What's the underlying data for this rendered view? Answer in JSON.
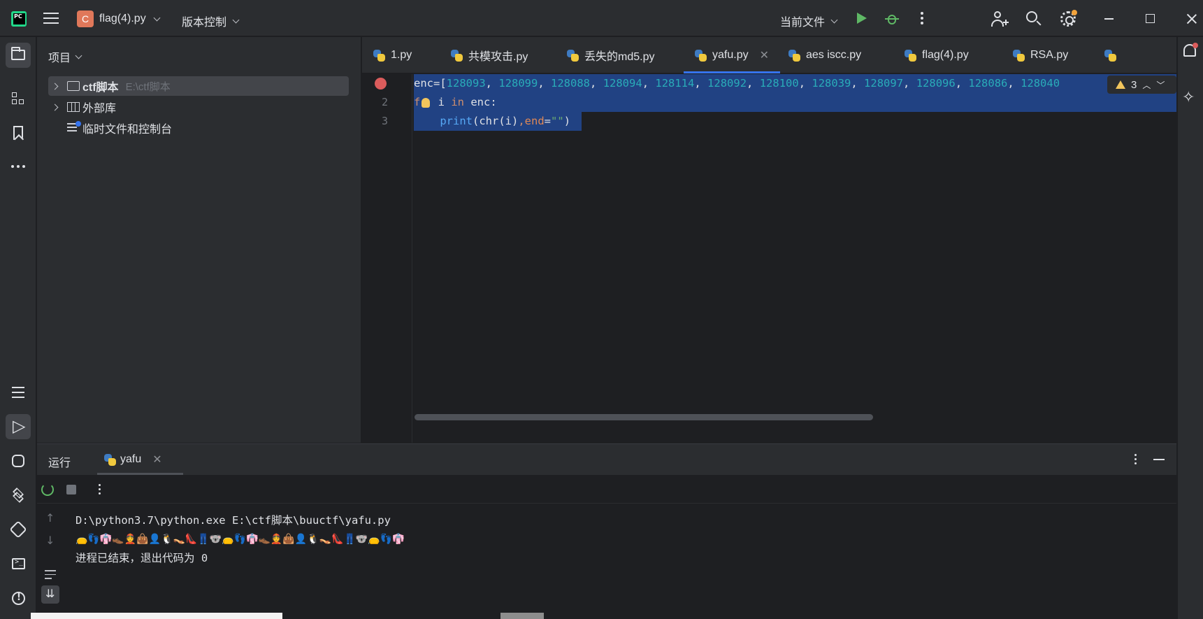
{
  "titlebar": {
    "project_badge": "C",
    "project_name": "flag(4).py",
    "vcs_label": "版本控制",
    "run_config": "当前文件"
  },
  "project_panel": {
    "title": "项目",
    "tree": [
      {
        "name": "ctf脚本",
        "path": "E:\\ctf脚本",
        "expanded": false
      },
      {
        "name": "外部库"
      },
      {
        "name": "临时文件和控制台"
      }
    ]
  },
  "editor_tabs": [
    {
      "label": "1.py"
    },
    {
      "label": "共模攻击.py"
    },
    {
      "label": "丢失的md5.py"
    },
    {
      "label": "yafu.py",
      "active": true
    },
    {
      "label": "aes iscc.py"
    },
    {
      "label": "flag(4).py"
    },
    {
      "label": "RSA.py"
    }
  ],
  "editor": {
    "line_numbers": [
      "2",
      "3"
    ],
    "warnings_count": "3",
    "lines": {
      "l1_prefix": "enc=[",
      "l1_numbers": [
        "128093",
        "128099",
        "128088",
        "128094",
        "128114",
        "128092",
        "128100",
        "128039",
        "128097",
        "128096",
        "128086",
        "128040"
      ],
      "l2_for": "f",
      "l2_rest_kw_in": "in",
      "l2_var": " i ",
      "l2_tail": " enc:",
      "l3_indent": "    ",
      "l3_print": "print",
      "l3_open": "(chr(i)",
      "l3_comma": ",",
      "l3_end": "end",
      "l3_eq": "=",
      "l3_str": "\"\"",
      "l3_close": ")"
    }
  },
  "run_panel": {
    "title": "运行",
    "tab_label": "yafu",
    "console": {
      "command": "D:\\python3.7\\python.exe E:\\ctf脚本\\buuctf\\yafu.py",
      "output": "👝👣👘👞👲👜👤🐧👡👠👖🐨👝👣👘👞👲👜👤🐧👡👠👖🐨👝👣👘",
      "exit_message": "进程已结束，退出代码为 0"
    }
  },
  "colors": {
    "accent": "#3574f0",
    "run_green": "#5fb865",
    "breakpoint_red": "#db5c5c",
    "selection": "#214283"
  }
}
